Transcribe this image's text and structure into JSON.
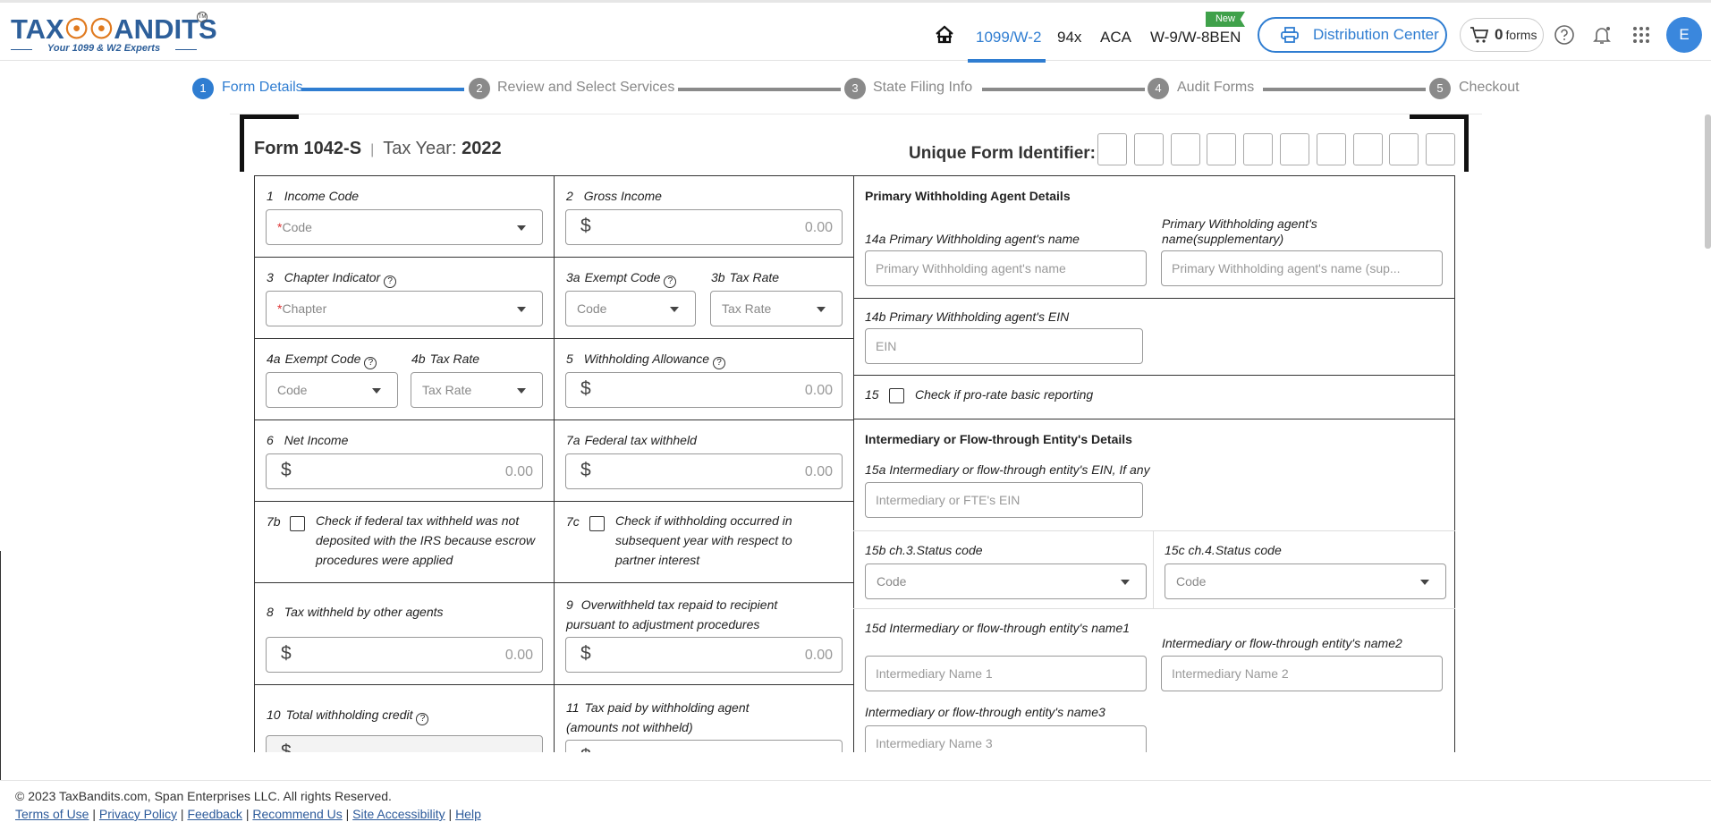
{
  "brand": {
    "logo_text": "TAXBANDITS",
    "tagline": "Your 1099 & W2 Experts"
  },
  "nav": {
    "items": [
      {
        "label": "1099/W-2",
        "active": true
      },
      {
        "label": "94x",
        "active": false
      },
      {
        "label": "ACA",
        "active": false
      },
      {
        "label": "W-9/W-8BEN",
        "active": false
      }
    ],
    "new_badge": "New",
    "distribution_center": "Distribution Center",
    "cart_count": "0",
    "cart_unit": "forms",
    "avatar_initial": "E"
  },
  "stepper": [
    {
      "num": "1",
      "label": "Form Details",
      "active": true
    },
    {
      "num": "2",
      "label": "Review and Select Services",
      "active": false
    },
    {
      "num": "3",
      "label": "State Filing Info",
      "active": false
    },
    {
      "num": "4",
      "label": "Audit Forms",
      "active": false
    },
    {
      "num": "5",
      "label": "Checkout",
      "active": false
    }
  ],
  "form": {
    "name": "Form 1042-S",
    "tax_year_label": "Tax Year:",
    "tax_year": "2022",
    "ufi_label": "Unique Form Identifier:",
    "ufi_box_count": 10
  },
  "fields": {
    "f1": {
      "num": "1",
      "label": "Income Code",
      "placeholder": "Code",
      "required": true
    },
    "f2": {
      "num": "2",
      "label": "Gross Income",
      "value": "0.00"
    },
    "f3": {
      "num": "3",
      "label": "Chapter Indicator",
      "placeholder": "Chapter",
      "required": true
    },
    "f3a": {
      "num": "3a",
      "label": "Exempt Code",
      "placeholder": "Code"
    },
    "f3b": {
      "num": "3b",
      "label": "Tax Rate",
      "placeholder": "Tax Rate"
    },
    "f4a": {
      "num": "4a",
      "label": "Exempt Code",
      "placeholder": "Code"
    },
    "f4b": {
      "num": "4b",
      "label": "Tax Rate",
      "placeholder": "Tax Rate"
    },
    "f5": {
      "num": "5",
      "label": "Withholding Allowance",
      "value": "0.00"
    },
    "f6": {
      "num": "6",
      "label": "Net Income",
      "value": "0.00"
    },
    "f7a": {
      "num": "7a",
      "label": "Federal tax withheld",
      "value": "0.00"
    },
    "f7b": {
      "num": "7b",
      "text": "Check if federal tax withheld was not deposited with the IRS because escrow procedures were applied"
    },
    "f7c": {
      "num": "7c",
      "text": "Check if withholding occurred in subsequent year with respect to partner interest"
    },
    "f8": {
      "num": "8",
      "label": "Tax withheld by other agents",
      "value": "0.00"
    },
    "f9": {
      "num": "9",
      "label": "Overwithheld tax repaid to recipient pursuant to adjustment procedures",
      "value": "0.00"
    },
    "f10": {
      "num": "10",
      "label": "Total withholding credit"
    },
    "f11": {
      "num": "11",
      "label": "Tax paid by withholding agent (amounts not withheld)"
    }
  },
  "agent": {
    "section_title": "Primary Withholding Agent Details",
    "name_label": "14a Primary Withholding agent's name",
    "name_placeholder": "Primary Withholding agent's name",
    "supp_label": "Primary Withholding agent's name(supplementary)",
    "supp_placeholder": "Primary Withholding agent's name (sup...",
    "ein_label": "14b Primary Withholding agent's EIN",
    "ein_placeholder": "EIN",
    "prorate_num": "15",
    "prorate_label": "Check if pro-rate basic reporting"
  },
  "intermediary": {
    "section_title": "Intermediary or Flow-through Entity's Details",
    "ein_label": "15a Intermediary or flow-through entity's EIN, If any",
    "ein_placeholder": "Intermediary or FTE's EIN",
    "ch3_label": "15b  ch.3.Status code",
    "ch3_placeholder": "Code",
    "ch4_label": "15c  ch.4.Status code",
    "ch4_placeholder": "Code",
    "name1_label": "15d  Intermediary or flow-through entity's name1",
    "name1_placeholder": "Intermediary Name 1",
    "name2_label": "Intermediary or flow-through entity's name2",
    "name2_placeholder": "Intermediary Name 2",
    "name3_label": "Intermediary or flow-through entity's name3",
    "name3_placeholder": "Intermediary Name 3"
  },
  "footer": {
    "copyright": "© 2023 TaxBandits.com, Span Enterprises LLC. All rights Reserved.",
    "links": [
      "Terms of Use",
      "Privacy Policy",
      "Feedback",
      "Recommend Us",
      "Site Accessibility",
      "Help"
    ]
  },
  "colors": {
    "accent": "#2f7dd1",
    "brand": "#2d5f9a",
    "new_badge": "#3fa14a",
    "step_inactive": "#8a8a8a"
  }
}
